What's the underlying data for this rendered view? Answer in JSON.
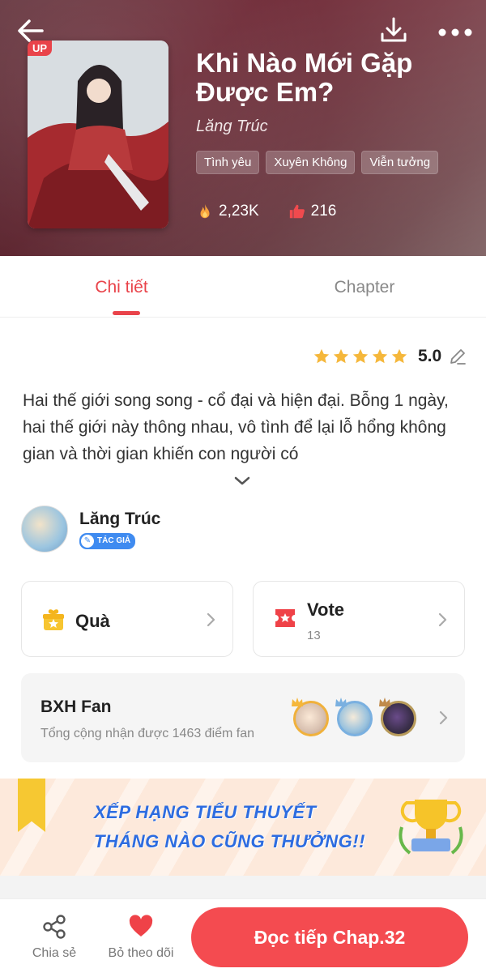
{
  "header": {
    "title": "Khi Nào Mới Gặp Được Em?",
    "author": "Lăng Trúc",
    "badge": "UP",
    "tags": [
      "Tình yêu",
      "Xuyên Không",
      "Viễn tưởng"
    ],
    "views": "2,23K",
    "likes": "216",
    "icons": {
      "back": "back-arrow-icon",
      "download": "download-icon",
      "more": "more-icon"
    }
  },
  "tabs": [
    {
      "label": "Chi tiết",
      "active": true
    },
    {
      "label": "Chapter",
      "active": false
    }
  ],
  "rating": {
    "stars": 5,
    "value": "5.0"
  },
  "description": "Hai thế giới song song - cổ đại và hiện đại. Bỗng 1 ngày, hai thế giới này thông nhau, vô tình để lại lỗ hổng không gian và thời gian khiến con người có",
  "author_section": {
    "name": "Lăng Trúc",
    "badge": "TÁC GIẢ"
  },
  "gift": {
    "label": "Quà"
  },
  "vote": {
    "label": "Vote",
    "count": "13"
  },
  "fan_ranking": {
    "title": "BXH Fan",
    "subtitle": "Tổng cộng nhận được 1463 điểm fan"
  },
  "banner": {
    "line1": "XẾP HẠNG TIỂU THUYẾT",
    "line2": "THÁNG NÀO CŨNG THƯỞNG!!"
  },
  "bottom_bar": {
    "share_label": "Chia sẻ",
    "unfollow_label": "Bỏ theo dõi",
    "read_button": "Đọc tiếp Chap.32"
  },
  "colors": {
    "accent": "#e9434a",
    "star": "#f5b73b",
    "blue": "#2d6ce0"
  }
}
